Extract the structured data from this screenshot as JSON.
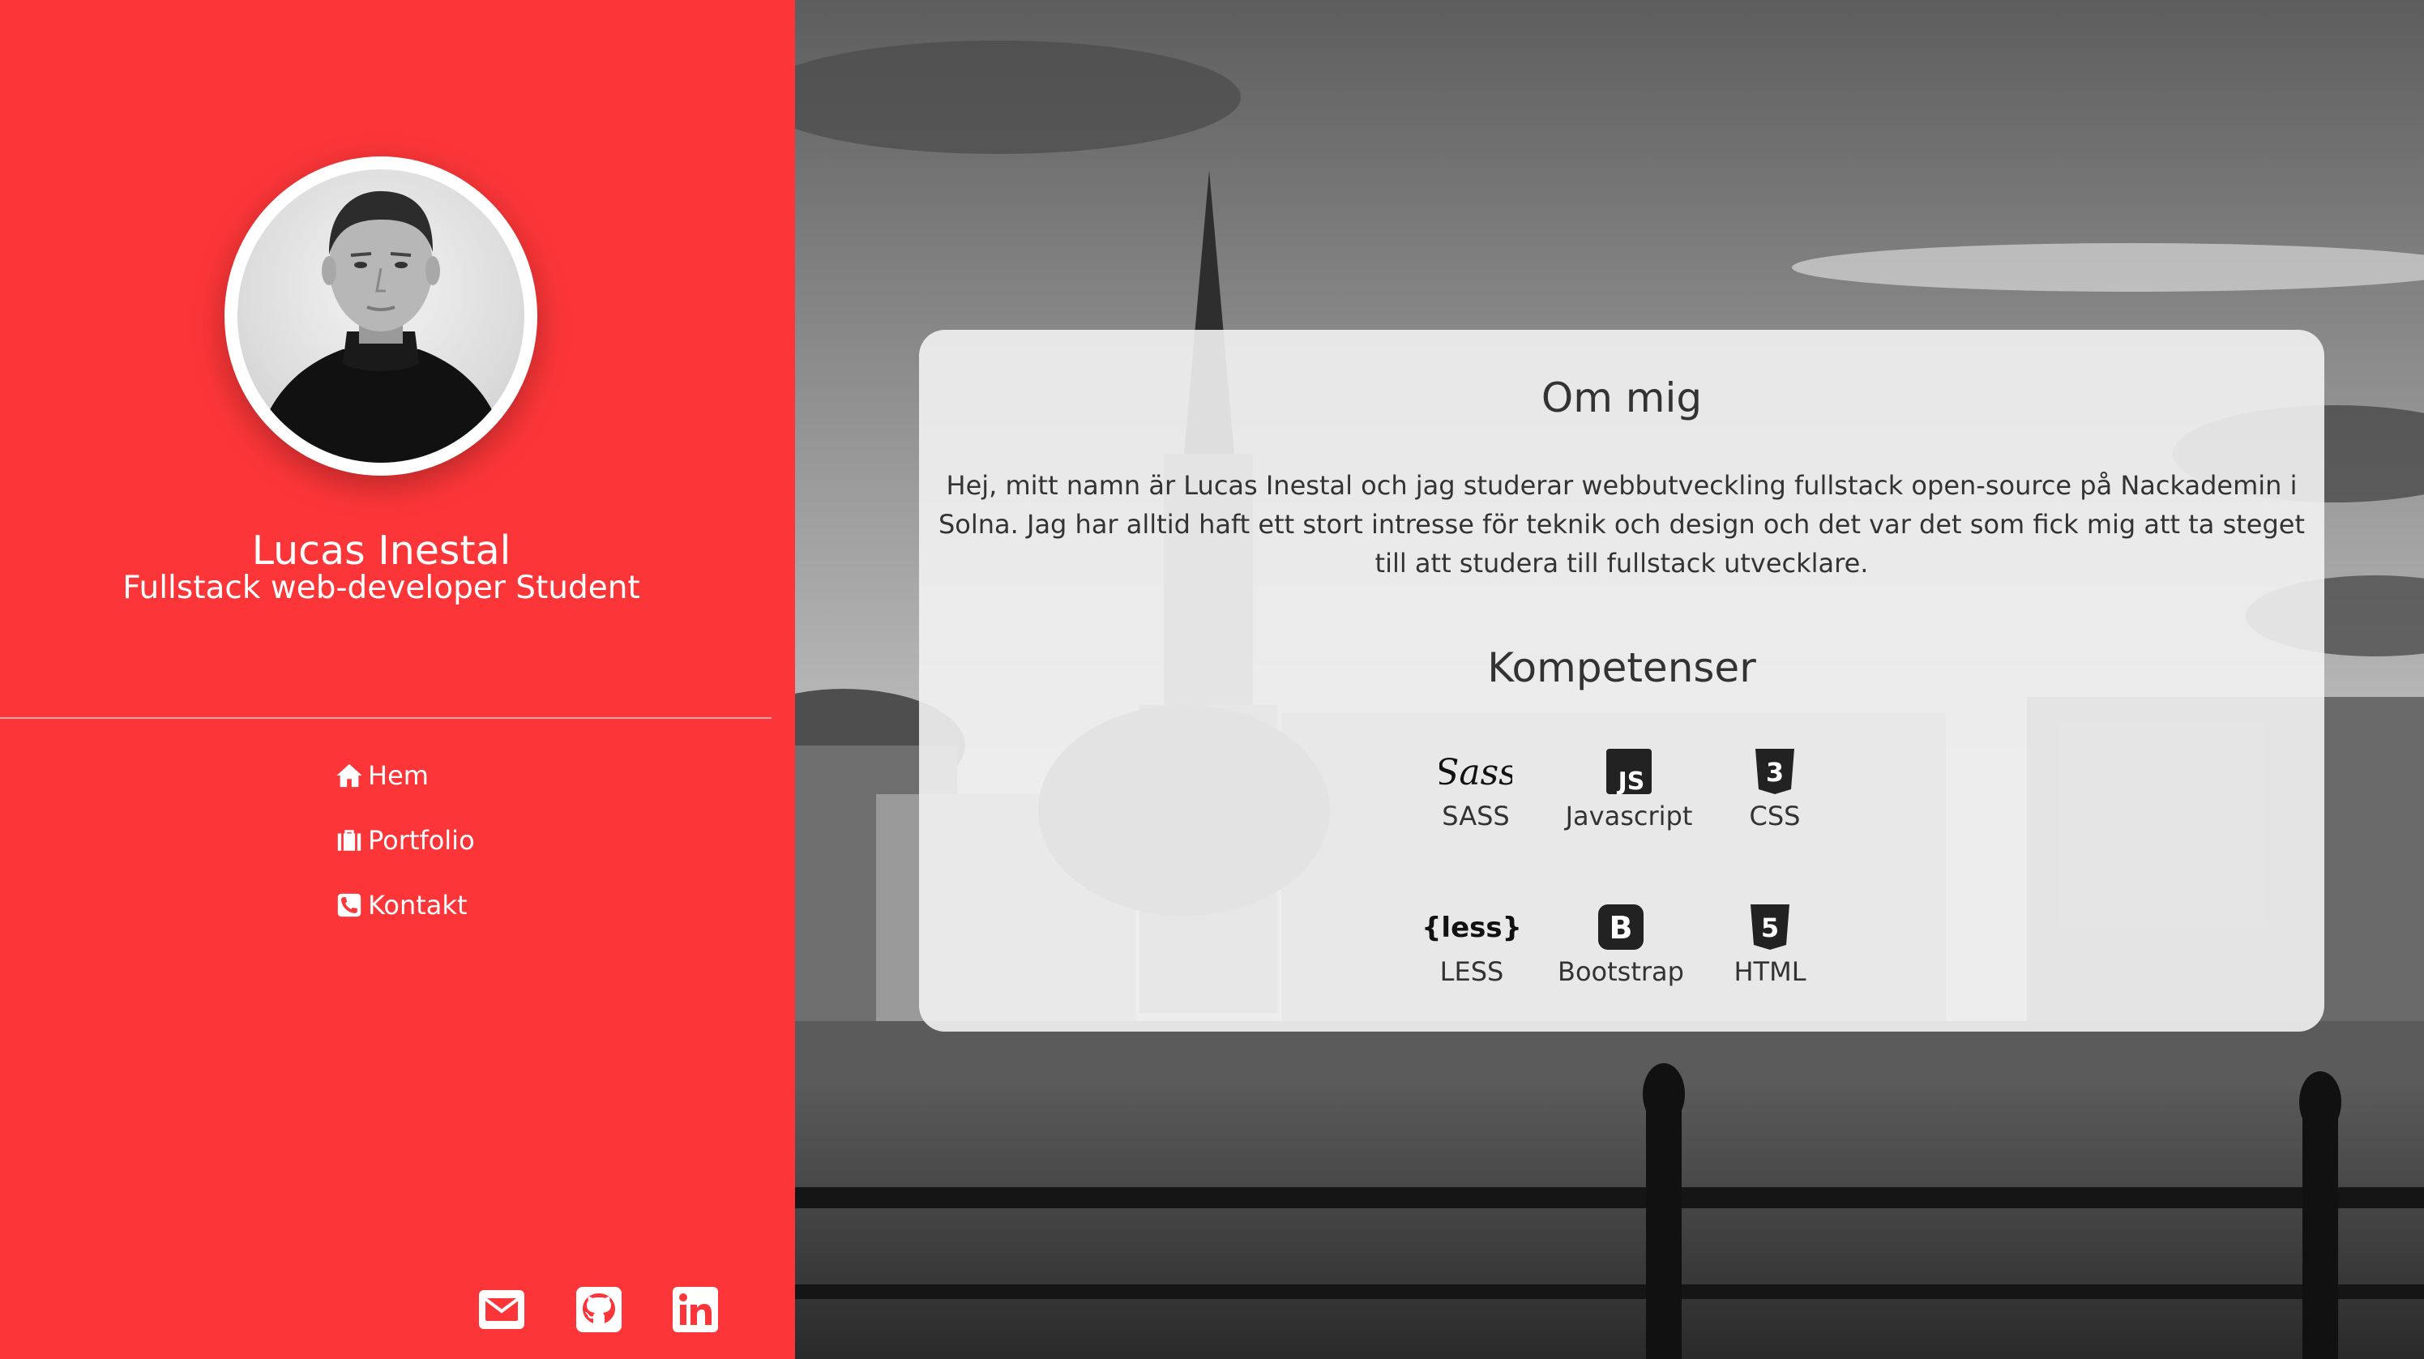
{
  "colors": {
    "accent": "#fc3638",
    "card_bg": "#f2f2f2",
    "text": "#333333"
  },
  "profile": {
    "name": "Lucas Inestal",
    "role": "Fullstack web-developer Student"
  },
  "nav": [
    {
      "label": "Hem",
      "icon": "home-icon"
    },
    {
      "label": "Portfolio",
      "icon": "briefcase-icon"
    },
    {
      "label": "Kontakt",
      "icon": "phone-icon"
    }
  ],
  "social": [
    {
      "icon": "envelope-icon"
    },
    {
      "icon": "github-icon"
    },
    {
      "icon": "linkedin-icon"
    }
  ],
  "about": {
    "title": "Om mig",
    "text": "Hej, mitt namn är Lucas Inestal och jag studerar webbutveckling fullstack open-source på Nackademin i Solna. Jag har alltid haft ett stort intresse för teknik och design och det var det som fick mig att ta steget till att studera till fullstack utvecklare."
  },
  "skills": {
    "title": "Kompetenser",
    "items": [
      {
        "label": "SASS",
        "icon": "sass-icon",
        "icon_text": "Sass"
      },
      {
        "label": "Javascript",
        "icon": "js-icon",
        "icon_text": "JS"
      },
      {
        "label": "CSS",
        "icon": "css3-icon",
        "icon_text": "3"
      },
      {
        "label": "LESS",
        "icon": "less-icon",
        "icon_text": "{less}"
      },
      {
        "label": "Bootstrap",
        "icon": "bootstrap-icon",
        "icon_text": "B"
      },
      {
        "label": "HTML",
        "icon": "html5-icon",
        "icon_text": "5"
      }
    ]
  }
}
